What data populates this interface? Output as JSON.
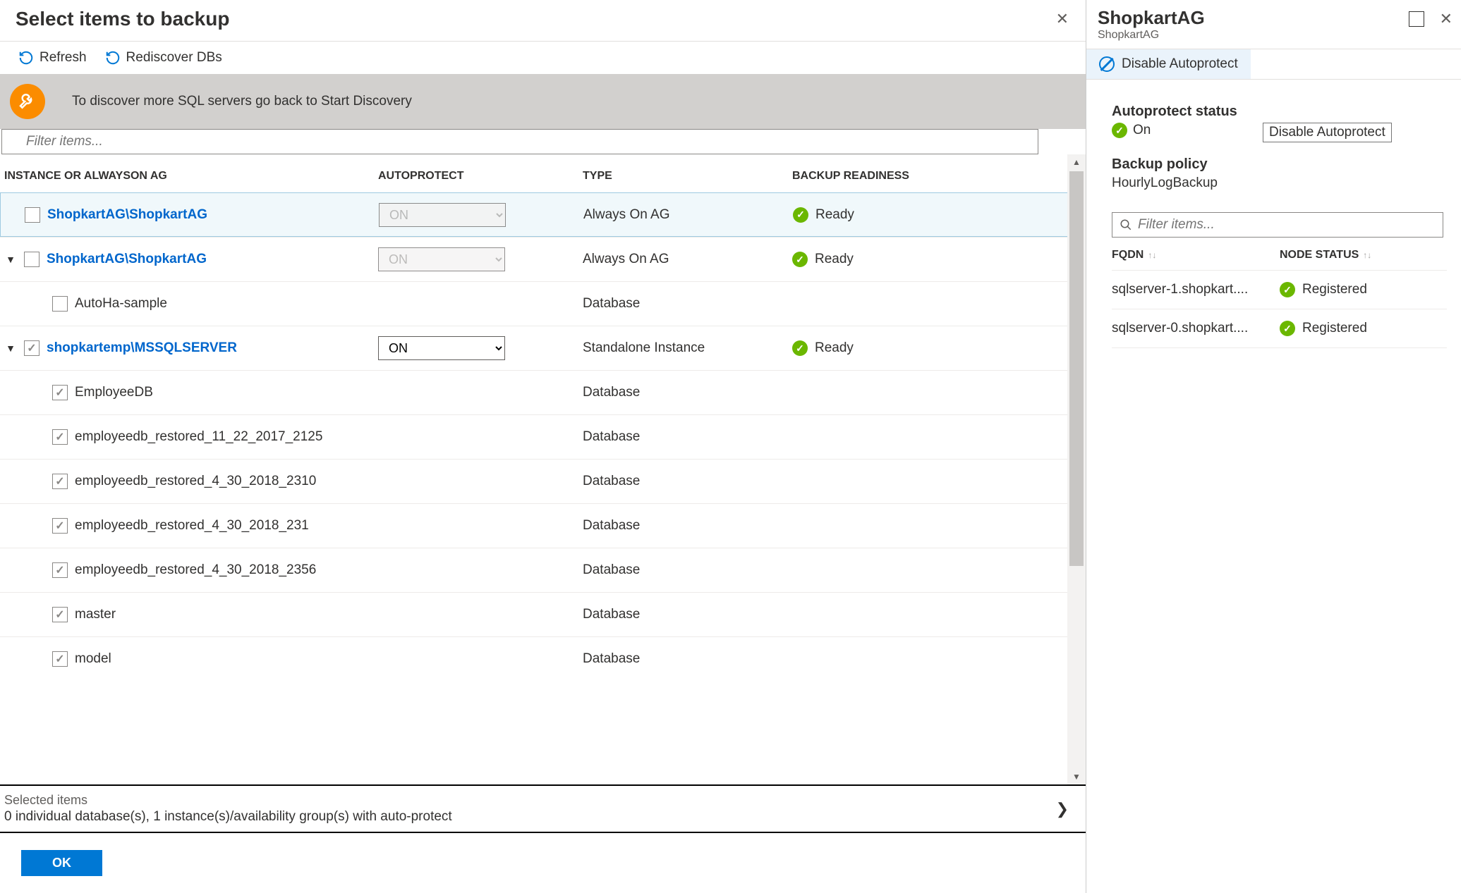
{
  "left": {
    "title": "Select items to backup",
    "toolbar": {
      "refresh": "Refresh",
      "rediscover": "Rediscover DBs"
    },
    "info": "To discover more SQL servers go back to Start Discovery",
    "filter_placeholder": "Filter items...",
    "columns": {
      "instance": "INSTANCE OR ALWAYSON AG",
      "autoprotect": "AUTOPROTECT",
      "type": "TYPE",
      "readiness": "BACKUP READINESS"
    },
    "rows": [
      {
        "caret": "",
        "checked": false,
        "name": "ShopkartAG\\ShopkartAG",
        "link": true,
        "autoprotect": "ON",
        "apDisabled": true,
        "type": "Always On AG",
        "ready": "Ready",
        "highlight": true,
        "indent": 0
      },
      {
        "caret": "▼",
        "checked": false,
        "name": "ShopkartAG\\ShopkartAG",
        "link": true,
        "autoprotect": "ON",
        "apDisabled": true,
        "type": "Always On AG",
        "ready": "Ready",
        "indent": 0
      },
      {
        "caret": "",
        "checked": false,
        "name": "AutoHa-sample",
        "link": false,
        "type": "Database",
        "indent": 1
      },
      {
        "caret": "▼",
        "checked": true,
        "name": "shopkartemp\\MSSQLSERVER",
        "link": true,
        "autoprotect": "ON",
        "apDisabled": false,
        "type": "Standalone Instance",
        "ready": "Ready",
        "indent": 0
      },
      {
        "caret": "",
        "checked": true,
        "name": "EmployeeDB",
        "link": false,
        "type": "Database",
        "indent": 1
      },
      {
        "caret": "",
        "checked": true,
        "name": "employeedb_restored_11_22_2017_2125",
        "link": false,
        "type": "Database",
        "indent": 1
      },
      {
        "caret": "",
        "checked": true,
        "name": "employeedb_restored_4_30_2018_2310",
        "link": false,
        "type": "Database",
        "indent": 1
      },
      {
        "caret": "",
        "checked": true,
        "name": "employeedb_restored_4_30_2018_231",
        "link": false,
        "type": "Database",
        "indent": 1
      },
      {
        "caret": "",
        "checked": true,
        "name": "employeedb_restored_4_30_2018_2356",
        "link": false,
        "type": "Database",
        "indent": 1
      },
      {
        "caret": "",
        "checked": true,
        "name": "master",
        "link": false,
        "type": "Database",
        "indent": 1
      },
      {
        "caret": "",
        "checked": true,
        "name": "model",
        "link": false,
        "type": "Database",
        "indent": 1
      }
    ],
    "summary": {
      "label": "Selected items",
      "text": "0 individual database(s), 1 instance(s)/availability group(s) with auto-protect"
    },
    "ok": "OK"
  },
  "right": {
    "title": "ShopkartAG",
    "subtitle": "ShopkartAG",
    "disable": "Disable Autoprotect",
    "tooltip": "Disable Autoprotect",
    "status_title": "Autoprotect status",
    "status_value": "On",
    "policy_title": "Backup policy",
    "policy_value": "HourlyLogBackup",
    "filter_placeholder": "Filter items...",
    "node_headers": {
      "fqdn": "FQDN",
      "status": "NODE STATUS"
    },
    "nodes": [
      {
        "fqdn": "sqlserver-1.shopkart....",
        "status": "Registered"
      },
      {
        "fqdn": "sqlserver-0.shopkart....",
        "status": "Registered"
      }
    ]
  }
}
